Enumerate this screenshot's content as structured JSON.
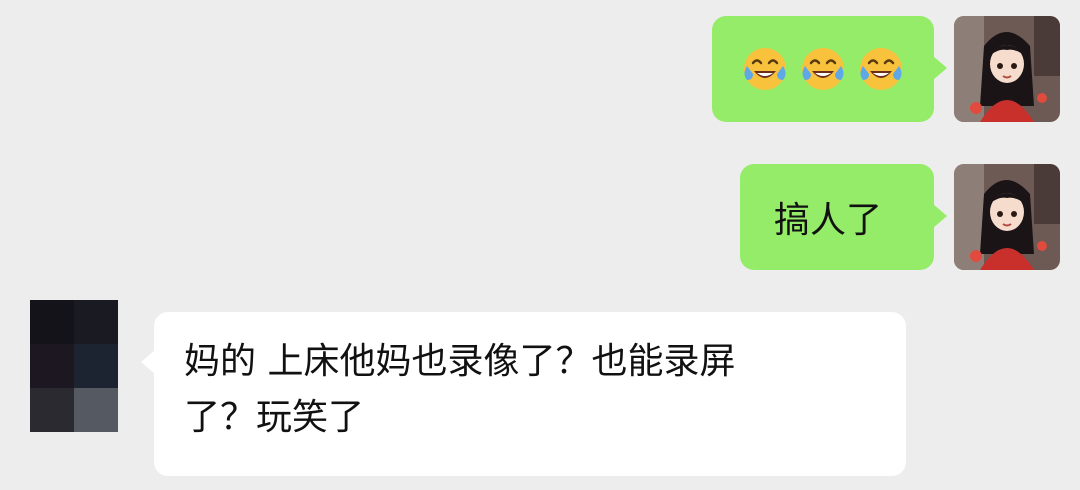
{
  "messages": [
    {
      "sender": "self",
      "type": "emoji",
      "emojis": [
        "face-with-tears-of-joy-icon",
        "face-with-tears-of-joy-icon",
        "face-with-tears-of-joy-icon"
      ]
    },
    {
      "sender": "self",
      "type": "text",
      "text": "搞人了"
    },
    {
      "sender": "other",
      "type": "text",
      "lines": [
        "妈的  上床他妈也录像了？也能录屏",
        "了？玩笑了"
      ]
    }
  ],
  "colors": {
    "background": "#ededed",
    "outgoing_bubble": "#95ec69",
    "incoming_bubble": "#ffffff",
    "text": "#111111",
    "emoji_face": "#f9c23c",
    "emoji_tear": "#5fa8e8"
  },
  "avatars": {
    "self": "girl-avatar-icon",
    "other": "pixelated-avatar-icon"
  }
}
